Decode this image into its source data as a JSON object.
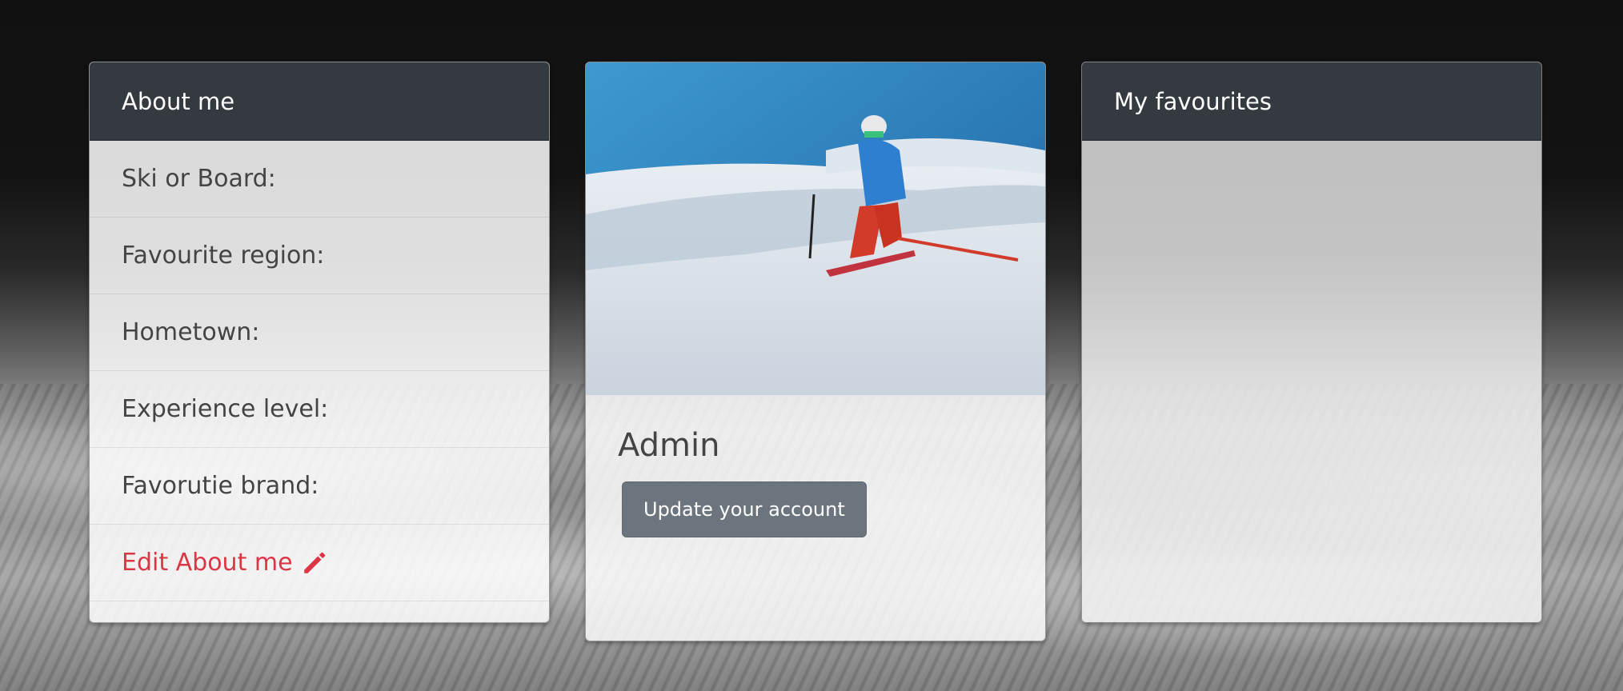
{
  "about": {
    "title": "About me",
    "items": [
      {
        "label": "Ski or Board:"
      },
      {
        "label": "Favourite region:"
      },
      {
        "label": "Hometown:"
      },
      {
        "label": "Experience level:"
      },
      {
        "label": "Favorutie brand:"
      }
    ],
    "edit_link": "Edit About me",
    "edit_icon": "pencil-icon",
    "accent_color": "#dc3545"
  },
  "profile": {
    "username": "Admin",
    "update_button": "Update your account",
    "photo": "skier-photo"
  },
  "favourites": {
    "title": "My favourites"
  },
  "colors": {
    "header_bg": "#343a40",
    "button_bg": "#6c757d"
  }
}
